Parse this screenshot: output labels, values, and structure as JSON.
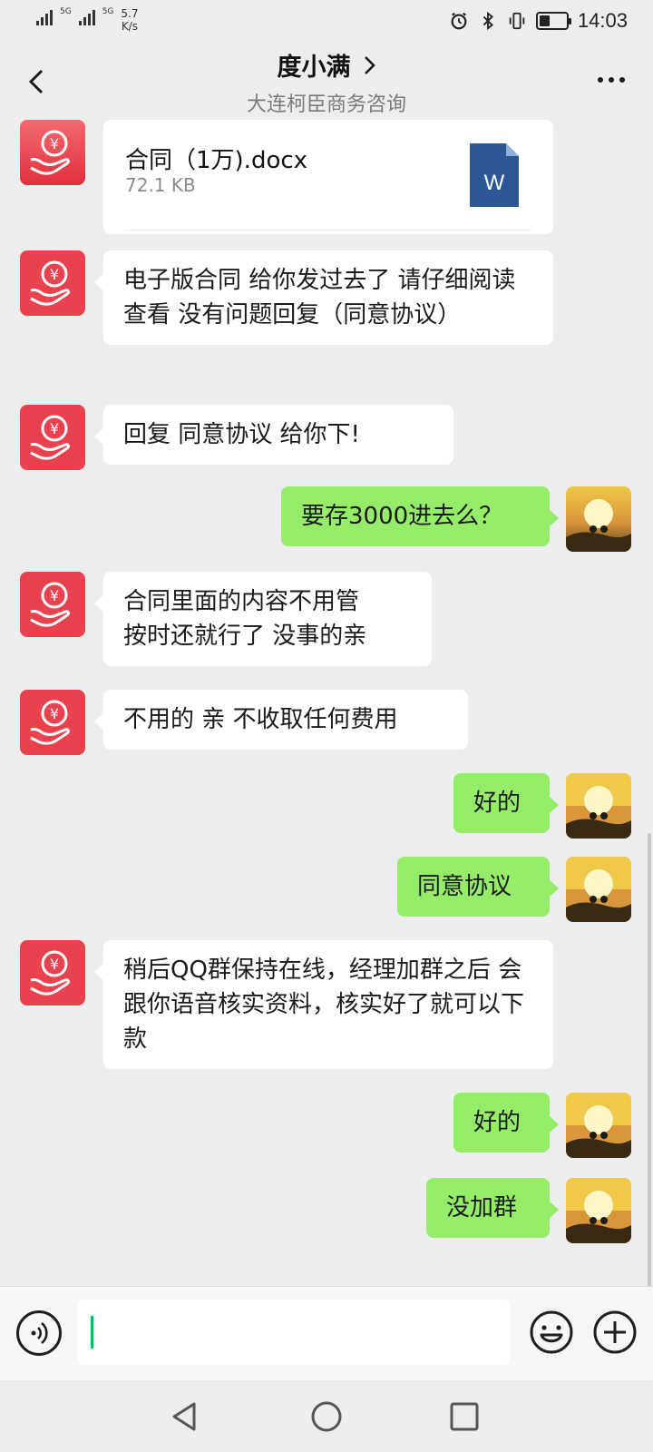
{
  "status_bar": {
    "network_tag_1": "5G",
    "network_tag_2": "5G",
    "speed_value": "5.7",
    "speed_unit": "K/s",
    "time": "14:03",
    "icons": [
      "alarm-icon",
      "bluetooth-icon",
      "vibrate-icon",
      "battery-icon"
    ]
  },
  "header": {
    "title": "度小满",
    "subtitle": "大连柯臣商务咨询",
    "back_icon": "back-chevron-icon",
    "more_icon": "more-dots-icon"
  },
  "messages": [
    {
      "from": "them",
      "type": "file",
      "file_name": "合同（1万).docx",
      "file_size": "72.1 KB",
      "file_icon": "word-doc-icon"
    },
    {
      "from": "them",
      "type": "text",
      "text": "电子版合同 给你发过去了 请仔细阅读查看 没有问题回复（同意协议）"
    },
    {
      "from": "them",
      "type": "text",
      "text": "回复 同意协议 给你下!"
    },
    {
      "from": "me",
      "type": "text",
      "text": "要存3000进去么？"
    },
    {
      "from": "them",
      "type": "text",
      "text": "合同里面的内容不用管\n按时还就行了 没事的亲"
    },
    {
      "from": "them",
      "type": "text",
      "text": "不用的 亲 不收取任何费用"
    },
    {
      "from": "me",
      "type": "text",
      "text": "好的"
    },
    {
      "from": "me",
      "type": "text",
      "text": "同意协议"
    },
    {
      "from": "them",
      "type": "text",
      "text": "稍后QQ群保持在线，经理加群之后 会跟你语音核实资料，核实好了就可以下款"
    },
    {
      "from": "me",
      "type": "text",
      "text": "好的"
    },
    {
      "from": "me",
      "type": "text",
      "text": "没加群"
    }
  ],
  "input_bar": {
    "value": "",
    "voice_icon": "voice-icon",
    "emoji_icon": "emoji-icon",
    "plus_icon": "plus-icon"
  },
  "nav_bar": {
    "icons": [
      "nav-back-icon",
      "nav-home-icon",
      "nav-recents-icon"
    ]
  },
  "colors": {
    "background": "#ededed",
    "incoming_bubble": "#ffffff",
    "outgoing_bubble": "#95ec69",
    "avatar_red": "#e8424f",
    "accent_green": "#07c160",
    "word_blue": "#2b5797"
  }
}
